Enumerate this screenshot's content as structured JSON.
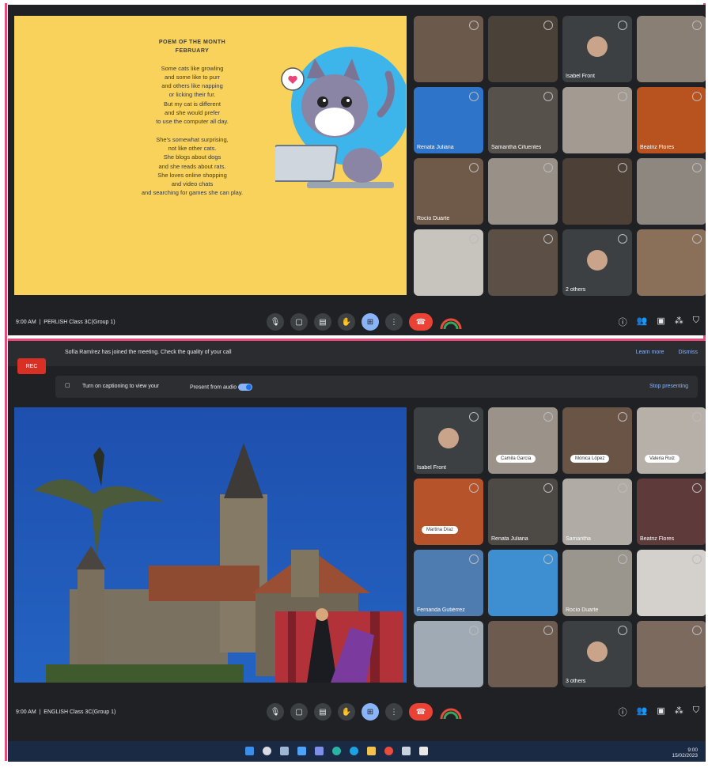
{
  "meeting1": {
    "time_label": "9:00 AM",
    "meeting_name": "PERLISH Class 3C(Group 1)",
    "poem_title_1": "POEM OF THE MONTH",
    "poem_title_2": "FEBRUARY",
    "poem_lines": [
      "Some cats like growling",
      "and some like to purr",
      "and others like napping",
      "or licking their fur.",
      "But my cat is different",
      "and she would prefer",
      "to use the computer all day.",
      "",
      "She's somewhat surprising,",
      "not like other cats.",
      "She blogs about dogs",
      "and she reads about rats.",
      "She loves online shopping",
      "and video chats",
      "and searching for games she can play."
    ],
    "participants": [
      {
        "name": "",
        "color": "#6b5a4c"
      },
      {
        "name": "",
        "color": "#4a4238"
      },
      {
        "name": "Isabel Front",
        "color": "#3c4043",
        "avatar": true
      },
      {
        "name": "",
        "color": "#8a7f74"
      },
      {
        "name": "Renata Juliana",
        "color": "#2e74c9"
      },
      {
        "name": "Samantha Cifuentes",
        "color": "#56514b"
      },
      {
        "name": "",
        "color": "#a39b92"
      },
      {
        "name": "Beatriz Flores",
        "color": "#b8531f"
      },
      {
        "name": "Rocío Duarte",
        "color": "#6f5a4a"
      },
      {
        "name": "",
        "color": "#999088"
      },
      {
        "name": "",
        "color": "#4d4036"
      },
      {
        "name": "",
        "color": "#8d8780"
      },
      {
        "name": "",
        "color": "#c7c3bd"
      },
      {
        "name": "",
        "color": "#5b4f46"
      },
      {
        "name": "2 others",
        "color": "#3c4043",
        "avatar": true
      },
      {
        "name": "",
        "color": "#8a6f59"
      }
    ]
  },
  "meeting2": {
    "notification_text": "Sofía Ramírez has joined the meeting. Check the quality of your call",
    "notification_link_1": "Learn more",
    "notification_link_2": "Dismiss",
    "rec_label": "REC",
    "panel_text": "Turn on captioning to view your",
    "panel_toggle_label": "Present from audio",
    "panel_link": "Stop presenting",
    "time_label": "9:00 AM",
    "meeting_name": "ENGLISH Class 3C(Group 1)",
    "participants": [
      {
        "name": "Isabel Front",
        "color": "#3c4043",
        "avatar": true
      },
      {
        "name": "",
        "color": "#9b938a",
        "caption": "Camila García"
      },
      {
        "name": "",
        "color": "#6a5446",
        "caption": "Mónica López"
      },
      {
        "name": "",
        "color": "#b6b0a9",
        "caption": "Valeria Ruiz"
      },
      {
        "name": "",
        "color": "#b7532a",
        "caption": "Martina Díaz"
      },
      {
        "name": "Renata Juliana",
        "color": "#4d4944"
      },
      {
        "name": "Samantha",
        "color": "#b0aba4"
      },
      {
        "name": "Beatriz Flores",
        "color": "#5e3a3a"
      },
      {
        "name": "Fernanda Gutiérrez",
        "color": "#4e7bb0"
      },
      {
        "name": "",
        "color": "#3d8fd1"
      },
      {
        "name": "Rocío Duarte",
        "color": "#9a958d"
      },
      {
        "name": "",
        "color": "#d4d0cb"
      },
      {
        "name": "",
        "color": "#a0aab4"
      },
      {
        "name": "",
        "color": "#6c5b4e"
      },
      {
        "name": "3 others",
        "color": "#3c4043",
        "avatar": true
      },
      {
        "name": "",
        "color": "#7d6a5e"
      }
    ]
  },
  "taskbar": {
    "time": "9:00",
    "date": "15/02/2023"
  },
  "colors": {
    "border": "#e84a7a",
    "meet_bg": "#202124",
    "slide_yellow": "#f9d25c",
    "scene_blue": "#1f58b5",
    "end_call_red": "#ea4335"
  }
}
